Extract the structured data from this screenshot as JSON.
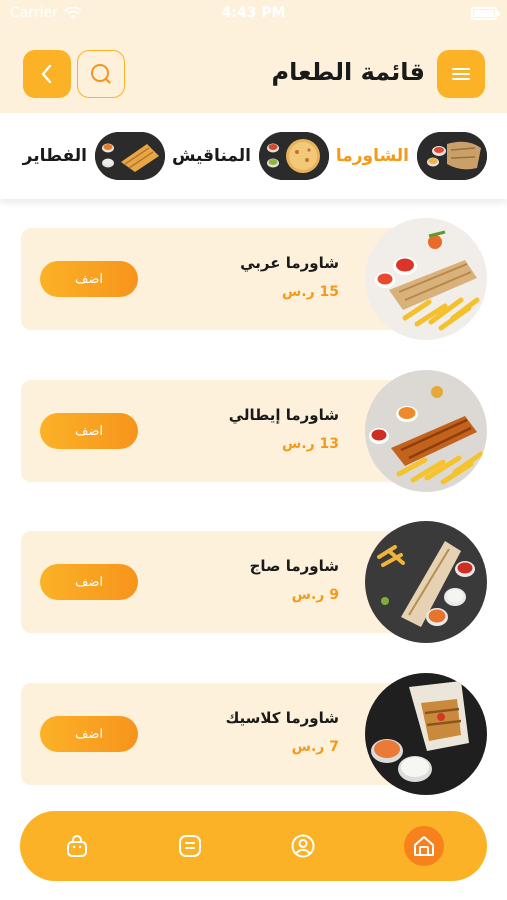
{
  "status_bar": {
    "carrier": "Carrier",
    "time": "4:43 PM"
  },
  "header": {
    "title": "قائمة الطعام"
  },
  "categories": [
    {
      "label": "الشاورما",
      "active": true
    },
    {
      "label": "المناقيش",
      "active": false
    },
    {
      "label": "الفطاير",
      "active": false
    }
  ],
  "items": [
    {
      "name": "شاورما عربي",
      "price": "15 ر.س",
      "add_label": "اضف"
    },
    {
      "name": "شاورما إيطالي",
      "price": "13 ر.س",
      "add_label": "اضف"
    },
    {
      "name": "شاورما صاج",
      "price": "9 ر.س",
      "add_label": "اضف"
    },
    {
      "name": "شاورما كلاسيك",
      "price": "7 ر.س",
      "add_label": "اضف"
    }
  ],
  "tabbar": {
    "icons": [
      "bag-icon",
      "list-icon",
      "profile-icon",
      "home-icon"
    ],
    "active": "home-icon"
  },
  "colors": {
    "accent": "#fbb226",
    "accent_dark": "#f7941d",
    "cream": "#fdf1dc",
    "price": "#f39a1a"
  }
}
